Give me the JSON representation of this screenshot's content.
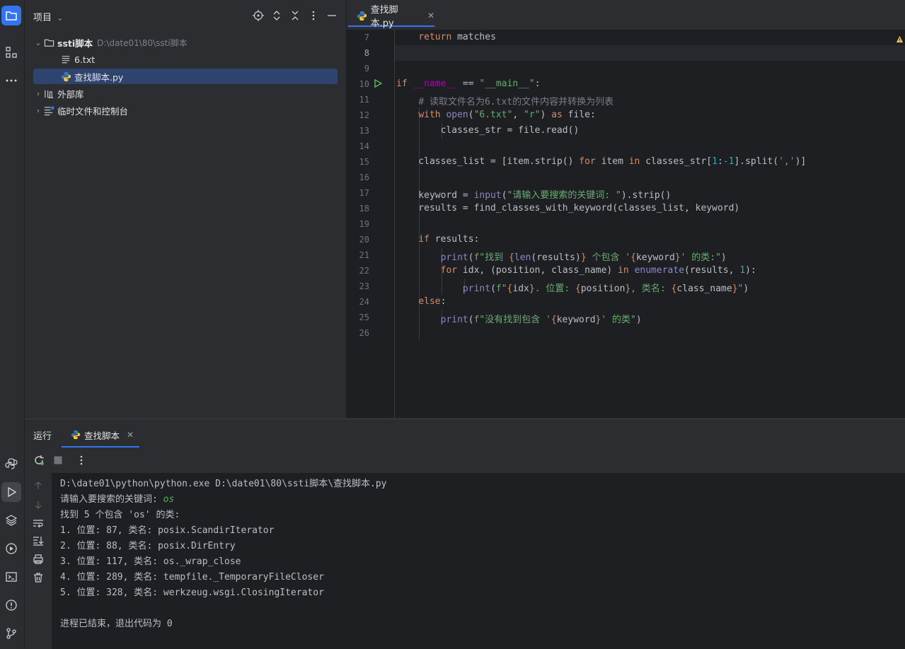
{
  "activity_bar": {
    "icons": [
      "folder-icon",
      "structure-icon",
      "more-icon",
      "python-console-icon",
      "run-icon",
      "layers-icon",
      "services-icon",
      "terminal-icon",
      "problems-icon",
      "git-icon"
    ]
  },
  "project_panel": {
    "title": "项目",
    "tree": [
      {
        "label": "ssti脚本",
        "note": "D:\\date01\\80\\ssti脚本",
        "expanded": true
      },
      {
        "label": "6.txt"
      },
      {
        "label": "查找脚本.py",
        "selected": true
      },
      {
        "label": "外部库",
        "expanded": false
      },
      {
        "label": "临时文件和控制台",
        "expanded": false
      }
    ]
  },
  "editor": {
    "tab_label": "查找脚本.py",
    "line_numbers": [
      "7",
      "8",
      "9",
      "10",
      "11",
      "12",
      "13",
      "14",
      "15",
      "16",
      "17",
      "18",
      "19",
      "20",
      "21",
      "22",
      "23",
      "24",
      "25",
      "26"
    ],
    "current_line": "8"
  },
  "run_panel": {
    "title": "运行",
    "tab_label": "查找脚本",
    "console": {
      "command": "D:\\date01\\python\\python.exe D:\\date01\\80\\ssti脚本\\查找脚本.py",
      "prompt": "请输入要搜索的关键词: ",
      "input": "os",
      "summary": "找到 5 个包含 'os' 的类:",
      "results": [
        "1. 位置: 87, 类名: posix.ScandirIterator",
        "2. 位置: 88, 类名: posix.DirEntry",
        "3. 位置: 117, 类名: os._wrap_close",
        "4. 位置: 289, 类名: tempfile._TemporaryFileCloser",
        "5. 位置: 328, 类名: werkzeug.wsgi.ClosingIterator"
      ],
      "exit_message": "进程已结束，退出代码为 0"
    }
  },
  "colors": {
    "accent": "#3574f0",
    "keyword": "#cf8e6d",
    "string": "#6aab73",
    "number": "#2aacb8",
    "function": "#56a8f5",
    "builtin": "#8888c6",
    "comment": "#7a7e85"
  }
}
